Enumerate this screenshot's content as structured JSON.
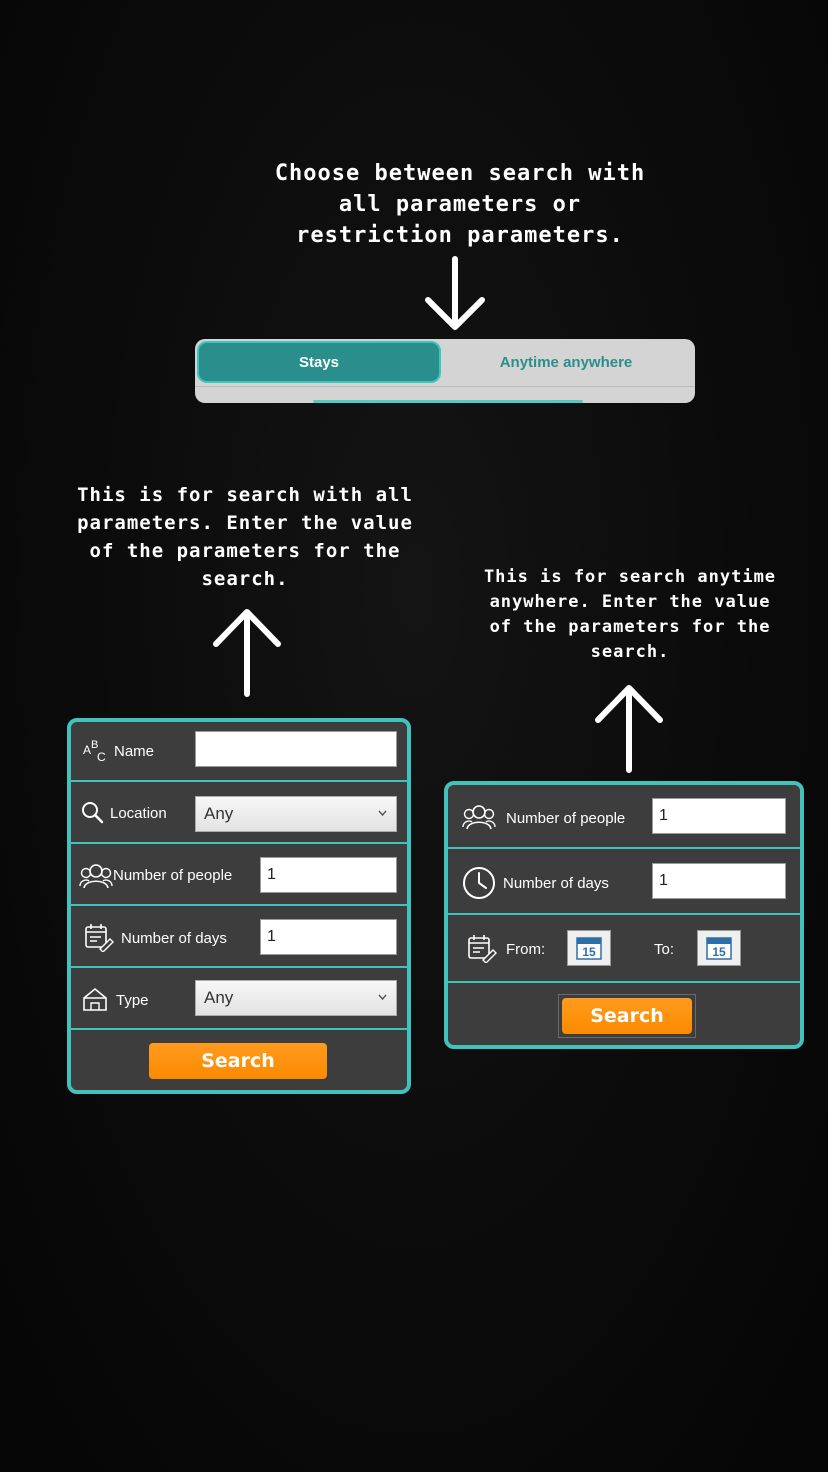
{
  "notes": {
    "top": [
      "Choose between search with",
      "all parameters or",
      "restriction parameters."
    ],
    "left": [
      "This is for search with all",
      "parameters. Enter the value",
      "of the parameters for the",
      "search."
    ],
    "right": [
      "This is for search anytime",
      "anywhere. Enter the value",
      "of the parameters for the",
      "search."
    ]
  },
  "tabs": {
    "stays": "Stays",
    "anytime": "Anytime anywhere"
  },
  "all_params_form": {
    "name_label": "Name",
    "name_value": "",
    "location_label": "Location",
    "location_value": "Any",
    "people_label": "Number of people",
    "people_value": "1",
    "days_label": "Number of days",
    "days_value": "1",
    "type_label": "Type",
    "type_value": "Any",
    "search_label": "Search"
  },
  "anytime_form": {
    "people_label": "Number of people",
    "people_value": "1",
    "days_label": "Number of days",
    "days_value": "1",
    "from_label": "From:",
    "to_label": "To:",
    "calendar_day": "15",
    "search_label": "Search"
  },
  "colors": {
    "accent": "#41c2bd",
    "tab_active": "#2a8f8c",
    "panel_bg": "#3d3d3d",
    "search_button": "#fb8a00"
  },
  "icons": [
    "down-arrow-icon",
    "up-arrow-icon",
    "abc-icon",
    "search-icon",
    "people-icon",
    "calendar-edit-icon",
    "house-icon",
    "clock-icon",
    "calendar-icon",
    "chevron-down-icon"
  ]
}
